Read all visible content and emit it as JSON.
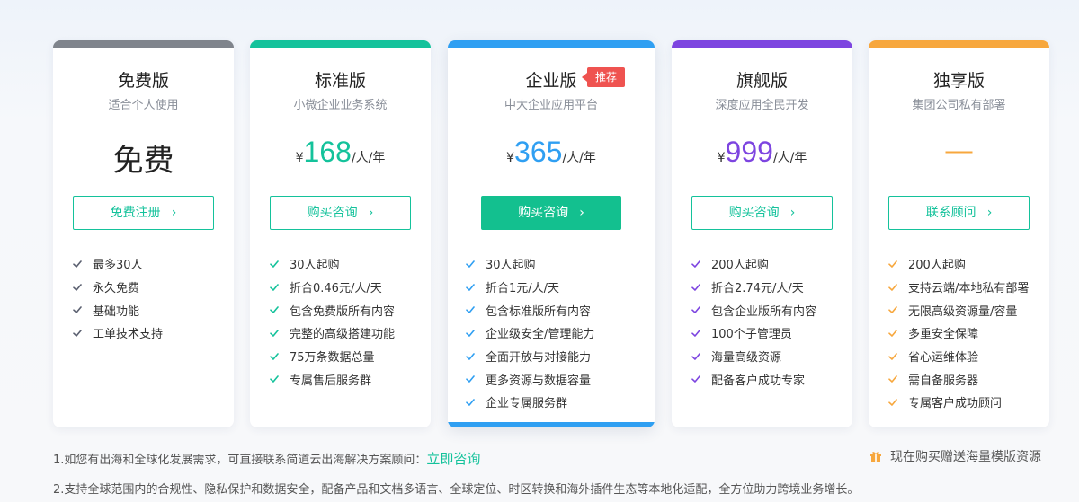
{
  "colors": {
    "free": "#7f848c",
    "standard": "#14c29b",
    "enterprise": "#2f9ff2",
    "flagship": "#7d45e0",
    "exclusive": "#f7a73d",
    "button_green": "#13c08f",
    "badge_red": "#ef5350"
  },
  "plans": [
    {
      "name": "免费版",
      "subtitle": "适合个人使用",
      "price_text": "免费",
      "button_label": "免费注册",
      "features": [
        "最多30人",
        "永久免费",
        "基础功能",
        "工单技术支持"
      ]
    },
    {
      "name": "标准版",
      "subtitle": "小微企业业务系统",
      "currency": "¥",
      "price": "168",
      "unit": "/人/年",
      "button_label": "购买咨询",
      "features": [
        "30人起购",
        "折合0.46元/人/天",
        "包含免费版所有内容",
        "完整的高级搭建功能",
        "75万条数据总量",
        "专属售后服务群"
      ]
    },
    {
      "name": "企业版",
      "subtitle": "中大企业应用平台",
      "badge": "推荐",
      "currency": "¥",
      "price": "365",
      "unit": "/人/年",
      "button_label": "购买咨询",
      "features": [
        "30人起购",
        "折合1元/人/天",
        "包含标准版所有内容",
        "企业级安全/管理能力",
        "全面开放与对接能力",
        "更多资源与数据容量",
        "企业专属服务群"
      ]
    },
    {
      "name": "旗舰版",
      "subtitle": "深度应用全民开发",
      "currency": "¥",
      "price": "999",
      "unit": "/人/年",
      "button_label": "购买咨询",
      "features": [
        "200人起购",
        "折合2.74元/人/天",
        "包含企业版所有内容",
        "100个子管理员",
        "海量高级资源",
        "配备客户成功专家"
      ]
    },
    {
      "name": "独享版",
      "subtitle": "集团公司私有部署",
      "price_text": "—",
      "button_label": "联系顾问",
      "features": [
        "200人起购",
        "支持云端/本地私有部署",
        "无限高级资源量/容量",
        "多重安全保障",
        "省心运维体验",
        "需自备服务器",
        "专属客户成功顾问"
      ]
    }
  ],
  "notes": {
    "note1_text": "1.如您有出海和全球化发展需求，可直接联系简道云出海解决方案顾问：",
    "note1_link": "立即咨询",
    "note2_text": "2.支持全球范围内的合规性、隐私保护和数据安全，配备产品和文档多语言、全球定位、时区转换和海外插件生态等本地化适配，全方位助力跨境业务增长。",
    "gift_text": "现在购买赠送海量模版资源",
    "gift_icon": "gift-icon"
  }
}
